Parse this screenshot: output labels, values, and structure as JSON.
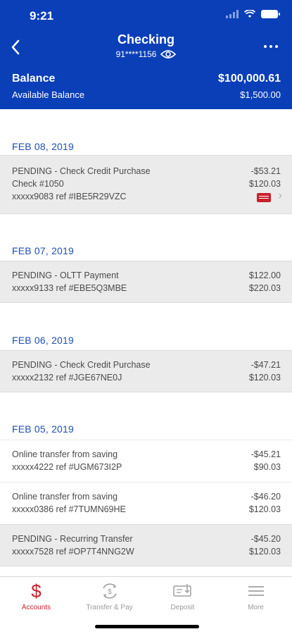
{
  "status_bar": {
    "time": "9:21"
  },
  "header": {
    "title": "Checking",
    "account_masked": "91****1156",
    "balance_label": "Balance",
    "balance_value": "$100,000.61",
    "available_label": "Available Balance",
    "available_value": "$1,500.00"
  },
  "dates": [
    "FEB 08, 2019",
    "FEB 07, 2019",
    "FEB 06, 2019",
    "FEB 05, 2019"
  ],
  "transactions": [
    {
      "title": "PENDING - Check Credit Purchase",
      "line2": "Check #1050",
      "line3": "xxxxx9083 ref #IBE5R29VZC",
      "amount": "-$53.21",
      "balance": "$120.03",
      "icon": "check-image-icon"
    },
    {
      "title": "PENDING - OLTT Payment",
      "line2": "xxxxx9133 ref #EBE5Q3MBE",
      "amount": "$122.00",
      "balance": "$220.03"
    },
    {
      "title": "PENDING - Check Credit Purchase",
      "line2": "xxxxx2132 ref #JGE67NE0J",
      "amount": "-$47.21",
      "balance": "$120.03"
    },
    {
      "title": "Online transfer from saving",
      "line2": "xxxxx4222 ref #UGM673I2P",
      "amount": "-$45.21",
      "balance": "$90.03"
    },
    {
      "title": "Online transfer from saving",
      "line2": "xxxxx0386 ref #7TUMN69HE",
      "amount": "-$46.20",
      "balance": "$120.03"
    },
    {
      "title": "PENDING - Recurring Transfer",
      "line2": "xxxxx7528 ref #OP7T4NNG2W",
      "amount": "-$45.20",
      "balance": "$120.03"
    }
  ],
  "tabs": [
    {
      "label": "Accounts",
      "icon": "dollar-icon",
      "active": true
    },
    {
      "label": "Transfer & Pay",
      "icon": "transfer-icon"
    },
    {
      "label": "Deposit",
      "icon": "deposit-icon"
    },
    {
      "label": "More",
      "icon": "menu-icon"
    }
  ],
  "colors": {
    "header_bg": "#0a3fb8",
    "accent": "#c8202b",
    "date_text": "#1f4fb5"
  }
}
